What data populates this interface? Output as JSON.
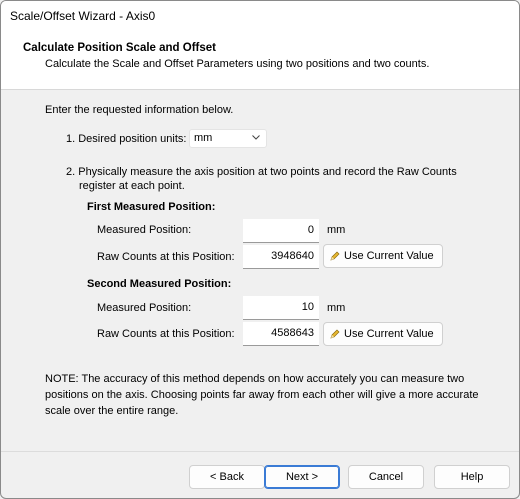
{
  "window": {
    "title": "Scale/Offset Wizard - Axis0"
  },
  "header": {
    "title": "Calculate Position Scale and Offset",
    "subtitle": "Calculate the Scale and Offset Parameters using two positions and two counts."
  },
  "body": {
    "intro": "Enter the requested information below.",
    "step1_label": "1. Desired position units:",
    "units_selected": "mm",
    "step2_line1": "2. Physically measure the axis position at two points and record the Raw Counts",
    "step2_line2": "register at each point.",
    "first": {
      "heading": "First Measured Position:",
      "measured_label": "Measured Position:",
      "measured_value": "0",
      "unit": "mm",
      "raw_label": "Raw Counts at this Position:",
      "raw_value": "3948640",
      "use_current_label": "Use Current Value"
    },
    "second": {
      "heading": "Second Measured Position:",
      "measured_label": "Measured Position:",
      "measured_value": "10",
      "unit": "mm",
      "raw_label": "Raw Counts at this Position:",
      "raw_value": "4588643",
      "use_current_label": "Use Current Value"
    },
    "note": "NOTE: The accuracy of this method depends on how accurately you can measure two positions on the axis. Choosing points far away from each other will give a more accurate scale over the entire range."
  },
  "buttons": {
    "back": "< Back",
    "next": "Next >",
    "cancel": "Cancel",
    "help": "Help"
  },
  "icons": {
    "dropdown": "chevron-down-icon",
    "use_current": "pencil-icon"
  }
}
